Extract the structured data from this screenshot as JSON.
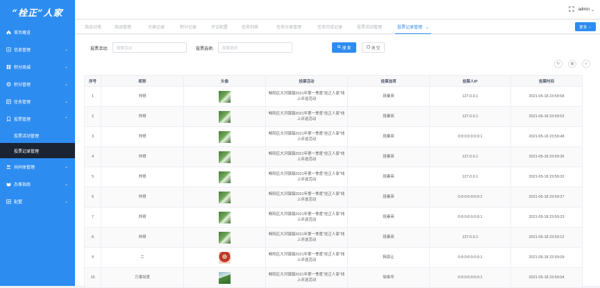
{
  "app": {
    "logo": "“栓正”人家"
  },
  "sidebar": {
    "items": [
      {
        "label": "首页概览",
        "icon": "home-icon",
        "expandable": false
      },
      {
        "label": "信息管理",
        "icon": "info-icon",
        "expandable": true
      },
      {
        "label": "积分商城",
        "icon": "mall-icon",
        "expandable": true
      },
      {
        "label": "积分管理",
        "icon": "points-icon",
        "expandable": true
      },
      {
        "label": "任务管理",
        "icon": "task-icon",
        "expandable": true
      },
      {
        "label": "投票管理",
        "icon": "vote-icon",
        "expandable": true,
        "expanded": true,
        "children": [
          {
            "label": "投票活动管理"
          },
          {
            "label": "投票记录管理",
            "active": true
          }
        ]
      },
      {
        "label": "共同体管理",
        "icon": "community-icon",
        "expandable": true
      },
      {
        "label": "办事指南",
        "icon": "guide-icon",
        "expandable": true
      },
      {
        "label": "配置",
        "icon": "config-icon",
        "expandable": true
      }
    ]
  },
  "topbar": {
    "user": "admin"
  },
  "tabs": [
    {
      "label": "商品分类"
    },
    {
      "label": "商品管理"
    },
    {
      "label": "兑换记录"
    },
    {
      "label": "积分记录"
    },
    {
      "label": "评议配置"
    },
    {
      "label": "任务列表"
    },
    {
      "label": "任务分类管理"
    },
    {
      "label": "任务完成记录"
    },
    {
      "label": "投票活动管理"
    },
    {
      "label": "投票记录管理",
      "active": true
    }
  ],
  "more_label": "更多",
  "search": {
    "activity_label": "投票活动:",
    "activity_placeholder": "投票活动",
    "option_label": "投票选项:",
    "option_placeholder": "投票选项",
    "search_btn": "搜 索",
    "reset_btn": "清 空"
  },
  "table": {
    "columns": [
      "序号",
      "昵称",
      "头像",
      "投票活动",
      "投票选项",
      "投票人IP",
      "投票时间"
    ],
    "rows": [
      {
        "no": "1",
        "nickname": "帅哥",
        "avatar": "shoot",
        "activity_l1": "畅阳区大河镇镇2021年第一季度“拴正人家”线",
        "activity_l2": "上评选活动",
        "option": "段秦英",
        "ip": "127.0.0.1",
        "time": "2021-05-18 23:59:58"
      },
      {
        "no": "2",
        "nickname": "帅哥",
        "avatar": "shoot",
        "activity_l1": "畅阳区大河镇镇2021年第一季度“拴正人家”线",
        "activity_l2": "上评选活动",
        "option": "段秦英",
        "ip": "127.0.0.1",
        "time": "2021-05-18 23:59:52"
      },
      {
        "no": "3",
        "nickname": "帅哥",
        "avatar": "shoot",
        "activity_l1": "畅阳区大河镇镇2021年第一季度“拴正人家”线",
        "activity_l2": "上评选活动",
        "option": "段秦英",
        "ip": "0:0:0:0:0:0:0:1",
        "time": "2021-05-18 23:59:48"
      },
      {
        "no": "4",
        "nickname": "帅哥",
        "avatar": "shoot",
        "activity_l1": "畅阳区大河镇镇2021年第一季度“拴正人家”线",
        "activity_l2": "上评选活动",
        "option": "段秦英",
        "ip": "127.0.0.1",
        "time": "2021-05-18 23:59:36"
      },
      {
        "no": "5",
        "nickname": "帅哥",
        "avatar": "shoot",
        "activity_l1": "畅阳区大河镇镇2021年第一季度“拴正人家”线",
        "activity_l2": "上评选活动",
        "option": "段秦英",
        "ip": "127.0.0.1",
        "time": "2021-05-18 23:59:32"
      },
      {
        "no": "6",
        "nickname": "帅哥",
        "avatar": "shoot",
        "activity_l1": "畅阳区大河镇镇2021年第一季度“拴正人家”线",
        "activity_l2": "上评选活动",
        "option": "段秦英",
        "ip": "0:0:0:0:0:0:0:1",
        "time": "2021-05-18 23:59:27"
      },
      {
        "no": "7",
        "nickname": "帅哥",
        "avatar": "shoot",
        "activity_l1": "畅阳区大河镇镇2021年第一季度“拴正人家”线",
        "activity_l2": "上评选活动",
        "option": "段秦英",
        "ip": "0:0:0:0:0:0:0:1",
        "time": "2021-05-18 23:59:23"
      },
      {
        "no": "8",
        "nickname": "帅哥",
        "avatar": "shoot",
        "activity_l1": "畅阳区大河镇镇2021年第一季度“拴正人家”线",
        "activity_l2": "上评选活动",
        "option": "段秦英",
        "ip": "127.0.0.1",
        "time": "2021-05-18 23:59:12"
      },
      {
        "no": "9",
        "nickname": "二",
        "avatar": "person",
        "activity_l1": "畅阳区大河镇镇2021年第一季度“拴正人家”线",
        "activity_l2": "上评选活动",
        "option": "韩恩让",
        "ip": "0:0:0:0:0:0:0:1",
        "time": "2021-05-18 23:59:09"
      },
      {
        "no": "10",
        "nickname": "万事如意",
        "avatar": "land",
        "activity_l1": "畅阳区大河镇镇2021年第一季度“拴正人家”线",
        "activity_l2": "上评选活动",
        "option": "徐俊坪",
        "ip": "0:0:0:0:0:0:0:1",
        "time": "2021-05-18 23:59:04"
      }
    ]
  },
  "colors": {
    "primary": "#2d8cf0",
    "sidebar_active": "#1a2433"
  }
}
